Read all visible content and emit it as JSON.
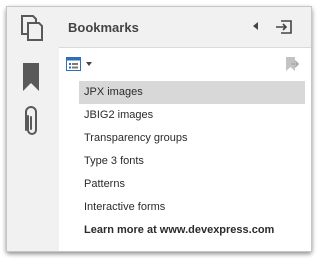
{
  "panel": {
    "title": "Bookmarks"
  },
  "sidebar": {
    "buttons": [
      {
        "name": "thumbnails",
        "icon": "pages-icon"
      },
      {
        "name": "bookmarks",
        "icon": "bookmark-icon",
        "active": true
      },
      {
        "name": "attachments",
        "icon": "paperclip-icon"
      }
    ]
  },
  "header": {
    "collapse_icon": "triangle-left-icon",
    "hide_icon": "hide-panel-icon"
  },
  "toolbar": {
    "options_icon": "bookmark-options-icon",
    "dropdown_icon": "chevron-down-icon",
    "goto_icon": "go-to-bookmark-icon"
  },
  "bookmarks": [
    {
      "label": "JPX images",
      "selected": true
    },
    {
      "label": "JBIG2 images"
    },
    {
      "label": "Transparency groups"
    },
    {
      "label": "Type 3 fonts"
    },
    {
      "label": "Patterns"
    },
    {
      "label": "Interactive forms"
    },
    {
      "label": "Learn more at www.devexpress.com",
      "bold": true
    }
  ],
  "colors": {
    "sidebar_bg": "#f1f1f1",
    "icon_gray": "#595959",
    "selected_row": "#d8d8d8",
    "accent_blue": "#2f6fb7"
  }
}
